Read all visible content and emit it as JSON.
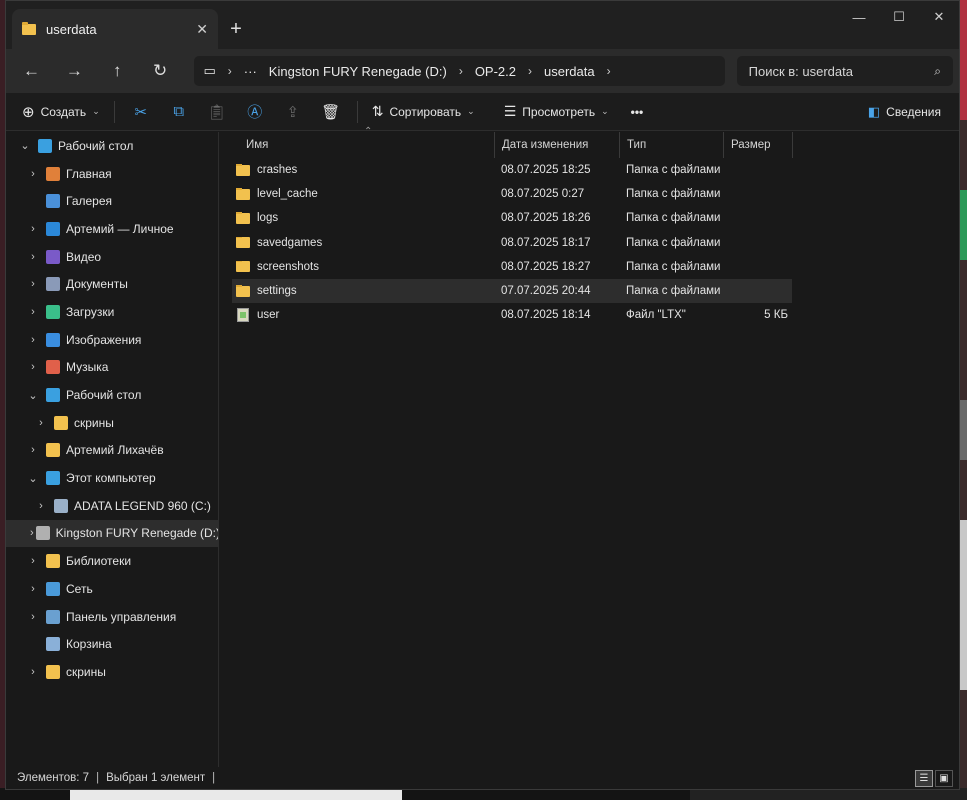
{
  "window": {
    "tab_title": "userdata",
    "controls": {
      "minimize": "—",
      "maximize": "☐",
      "close": "✕"
    }
  },
  "nav": {
    "back": "←",
    "forward": "→",
    "up": "↑",
    "refresh": "↻",
    "breadcrumb": [
      "Kingston FURY Renegade (D:)",
      "OP-2.2",
      "userdata"
    ],
    "search_placeholder": "Поиск в: userdata"
  },
  "toolbar": {
    "create": "Создать",
    "sort": "Сортировать",
    "view": "Просмотреть",
    "more": "•••",
    "details": "Сведения"
  },
  "sidebar": {
    "items": [
      {
        "label": "Рабочий стол",
        "arrow": "⌄",
        "indent": 0,
        "color": "#3aa0e0"
      },
      {
        "label": "Главная",
        "arrow": "›",
        "indent": 1,
        "color": "#e0803a"
      },
      {
        "label": "Галерея",
        "arrow": "",
        "indent": 1,
        "color": "#4a90d9"
      },
      {
        "label": "Артемий — Личное",
        "arrow": "›",
        "indent": 1,
        "color": "#2b88d8"
      },
      {
        "label": "Видео",
        "arrow": "›",
        "indent": 1,
        "color": "#7a5ac8"
      },
      {
        "label": "Документы",
        "arrow": "›",
        "indent": 1,
        "color": "#8a9ab8"
      },
      {
        "label": "Загрузки",
        "arrow": "›",
        "indent": 1,
        "color": "#3abf8a"
      },
      {
        "label": "Изображения",
        "arrow": "›",
        "indent": 1,
        "color": "#3a8ee0"
      },
      {
        "label": "Музыка",
        "arrow": "›",
        "indent": 1,
        "color": "#e0604a"
      },
      {
        "label": "Рабочий стол",
        "arrow": "⌄",
        "indent": 1,
        "color": "#3aa0e0"
      },
      {
        "label": "скрины",
        "arrow": "›",
        "indent": 2,
        "color": "#f2c14e"
      },
      {
        "label": "Артемий Лихачёв",
        "arrow": "›",
        "indent": 1,
        "color": "#f2c14e"
      },
      {
        "label": "Этот компьютер",
        "arrow": "⌄",
        "indent": 1,
        "color": "#3aa0e0"
      },
      {
        "label": "ADATA LEGEND 960 (C:)",
        "arrow": "›",
        "indent": 2,
        "color": "#9ab0c8"
      },
      {
        "label": "Kingston FURY Renegade (D:)",
        "arrow": "›",
        "indent": 2,
        "color": "#b0b0b0",
        "selected": true
      },
      {
        "label": "Библиотеки",
        "arrow": "›",
        "indent": 1,
        "color": "#f2c14e"
      },
      {
        "label": "Сеть",
        "arrow": "›",
        "indent": 1,
        "color": "#4a9ad9"
      },
      {
        "label": "Панель управления",
        "arrow": "›",
        "indent": 1,
        "color": "#6aa0d0"
      },
      {
        "label": "Корзина",
        "arrow": "",
        "indent": 1,
        "color": "#8ab0d8"
      },
      {
        "label": "скрины",
        "arrow": "›",
        "indent": 1,
        "color": "#f2c14e"
      }
    ]
  },
  "columns": {
    "name": "Имя",
    "date": "Дата изменения",
    "type": "Тип",
    "size": "Размер"
  },
  "files": [
    {
      "name": "crashes",
      "date": "08.07.2025 18:25",
      "type": "Папка с файлами",
      "size": "",
      "kind": "folder"
    },
    {
      "name": "level_cache",
      "date": "08.07.2025 0:27",
      "type": "Папка с файлами",
      "size": "",
      "kind": "folder"
    },
    {
      "name": "logs",
      "date": "08.07.2025 18:26",
      "type": "Папка с файлами",
      "size": "",
      "kind": "folder"
    },
    {
      "name": "savedgames",
      "date": "08.07.2025 18:17",
      "type": "Папка с файлами",
      "size": "",
      "kind": "folder"
    },
    {
      "name": "screenshots",
      "date": "08.07.2025 18:27",
      "type": "Папка с файлами",
      "size": "",
      "kind": "folder"
    },
    {
      "name": "settings",
      "date": "07.07.2025 20:44",
      "type": "Папка с файлами",
      "size": "",
      "kind": "folder",
      "selected": true
    },
    {
      "name": "user",
      "date": "08.07.2025 18:14",
      "type": "Файл \"LTX\"",
      "size": "5 КБ",
      "kind": "file"
    }
  ],
  "status": {
    "items_count": "Элементов: 7",
    "selected": "Выбран 1 элемент"
  }
}
